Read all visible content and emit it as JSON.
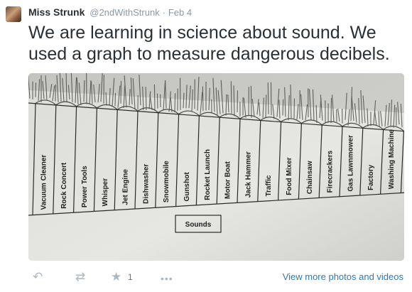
{
  "tweet": {
    "avatar_icon": "user-avatar",
    "name": "Miss Strunk",
    "handle": "@2ndWithStrunk",
    "separator": "·",
    "date": "Feb 4",
    "text": "We are learning in science about sound. We used a graph to measure dangerous decibels."
  },
  "photo": {
    "x_labels": [
      "Vacuum Cleaner",
      "Rock Concert",
      "Power Tools",
      "Whisper",
      "Jet Engine",
      "Dishwasher",
      "Snowmobile",
      "Gunshot",
      "Rocket Launch",
      "Motor Boat",
      "Jack Hammer",
      "Traffic",
      "Food Mixer",
      "Chainsaw",
      "Firecrackers",
      "Gas Lawnmower",
      "Factory",
      "Washing Machine"
    ],
    "axis_title": "Sounds"
  },
  "actions": {
    "reply_icon": "reply-icon",
    "retweet_icon": "retweet-icon",
    "favorite_icon": "star-icon",
    "favorite_count": "1",
    "more_icon": "more-icon",
    "view_more": "View more photos and videos",
    "icon_color": "#aab8c2",
    "link_color": "#2b7bb9"
  }
}
